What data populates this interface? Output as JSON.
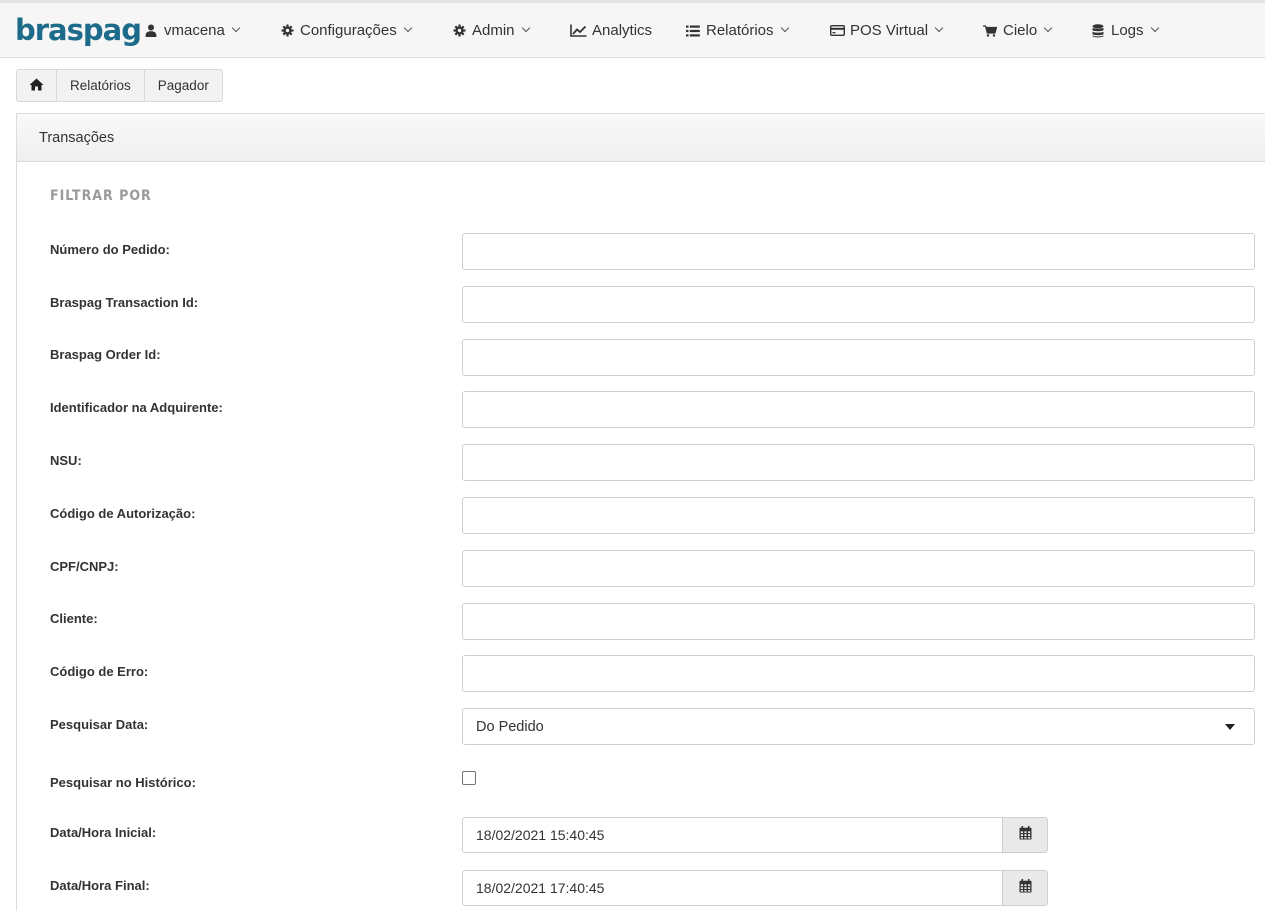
{
  "navbar": {
    "logo": "braspag",
    "items": [
      {
        "label": "vmacena",
        "icon": "user-icon",
        "has_caret": true
      },
      {
        "label": "Configurações",
        "icon": "gear-icon",
        "has_caret": true
      },
      {
        "label": "Admin",
        "icon": "gear-icon",
        "has_caret": true
      },
      {
        "label": "Analytics",
        "icon": "line-chart-icon",
        "has_caret": false
      },
      {
        "label": "Relatórios",
        "icon": "list-icon",
        "has_caret": true
      },
      {
        "label": "POS Virtual",
        "icon": "credit-card-icon",
        "has_caret": true
      },
      {
        "label": "Cielo",
        "icon": "cart-icon",
        "has_caret": true
      },
      {
        "label": "Logs",
        "icon": "database-icon",
        "has_caret": true
      }
    ]
  },
  "breadcrumb": {
    "home_icon": "home-icon",
    "items": [
      "Relatórios",
      "Pagador"
    ]
  },
  "panel": {
    "title": "Transações",
    "filter_title": "FILTRAR POR",
    "fields": [
      {
        "label": "Número do Pedido:",
        "value": ""
      },
      {
        "label": "Braspag Transaction Id:",
        "value": ""
      },
      {
        "label": "Braspag Order Id:",
        "value": ""
      },
      {
        "label": "Identificador na Adquirente:",
        "value": ""
      },
      {
        "label": "NSU:",
        "value": ""
      },
      {
        "label": "Código de Autorização:",
        "value": ""
      },
      {
        "label": "CPF/CNPJ:",
        "value": ""
      },
      {
        "label": "Cliente:",
        "value": ""
      },
      {
        "label": "Código de Erro:",
        "value": ""
      }
    ],
    "date_search": {
      "label": "Pesquisar Data:",
      "selected": "Do Pedido"
    },
    "history": {
      "label": "Pesquisar no Histórico:",
      "checked": false
    },
    "start_datetime": {
      "label": "Data/Hora Inicial:",
      "value": "18/02/2021 15:40:45",
      "icon": "calendar-icon"
    },
    "end_datetime": {
      "label": "Data/Hora Final:",
      "value": "18/02/2021 17:40:45",
      "icon": "calendar-icon"
    }
  }
}
